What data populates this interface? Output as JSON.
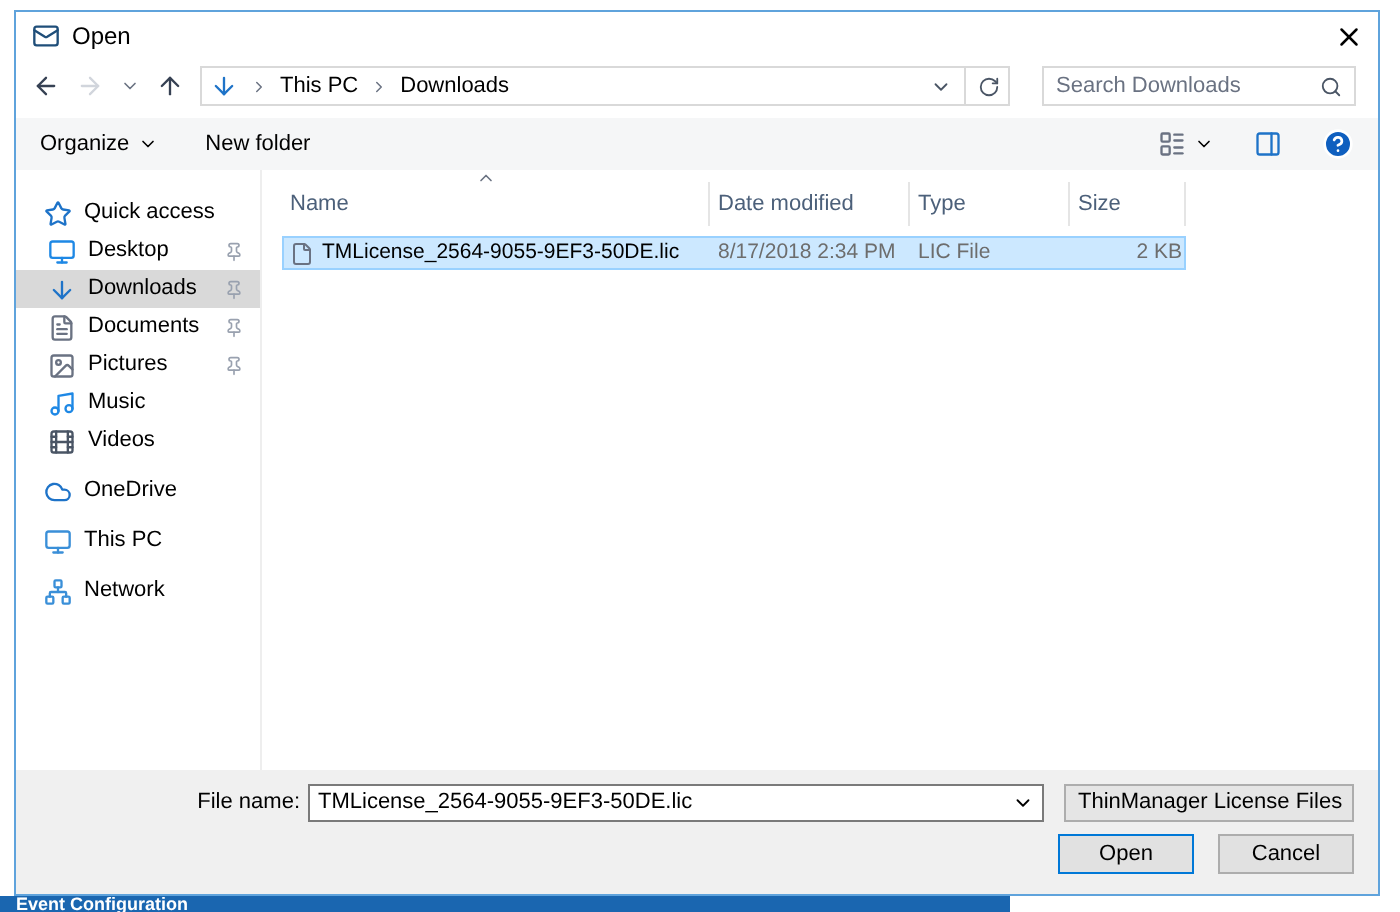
{
  "window": {
    "title": "Open"
  },
  "address": {
    "path": [
      "This PC",
      "Downloads"
    ]
  },
  "search": {
    "placeholder": "Search Downloads"
  },
  "toolbar": {
    "organize": "Organize",
    "new_folder": "New folder"
  },
  "sidebar": {
    "items": [
      {
        "label": "Quick access",
        "kind": "star",
        "selected": false,
        "children": [
          {
            "label": "Desktop",
            "kind": "desktop",
            "selected": false,
            "pinned": true
          },
          {
            "label": "Downloads",
            "kind": "download",
            "selected": true,
            "pinned": true
          },
          {
            "label": "Documents",
            "kind": "document",
            "selected": false,
            "pinned": true
          },
          {
            "label": "Pictures",
            "kind": "picture",
            "selected": false,
            "pinned": true
          },
          {
            "label": "Music",
            "kind": "music",
            "selected": false,
            "pinned": false
          },
          {
            "label": "Videos",
            "kind": "video",
            "selected": false,
            "pinned": false
          }
        ]
      },
      {
        "label": "OneDrive",
        "kind": "cloud",
        "selected": false
      },
      {
        "label": "This PC",
        "kind": "pc",
        "selected": false
      },
      {
        "label": "Network",
        "kind": "network",
        "selected": false
      }
    ]
  },
  "table": {
    "columns": [
      "Name",
      "Date modified",
      "Type",
      "Size"
    ],
    "rows": [
      {
        "cells": [
          "TMLicense_2564-9055-9EF3-50DE.lic",
          "8/17/2018 2:34 PM",
          "LIC File",
          "2 KB"
        ],
        "selected": true
      }
    ]
  },
  "footer": {
    "file_name_label": "File name:",
    "file_name": "TMLicense_2564-9055-9EF3-50DE.lic",
    "file_type": "ThinManager License Files",
    "buttons": [
      "Open",
      "Cancel"
    ]
  },
  "background": {
    "status": "Event Configuration"
  }
}
